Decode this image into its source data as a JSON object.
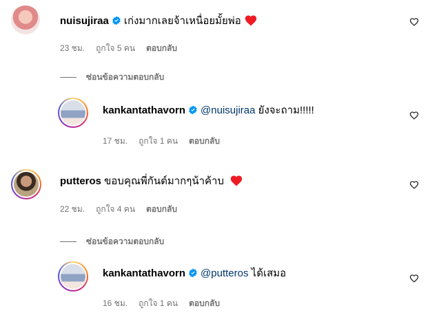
{
  "comments": [
    {
      "username": "nuisujiraa",
      "verified": true,
      "text": "เก่งมากเลยจ้าเหนื่อยมั้ยพ่อ",
      "emoji": "heart",
      "time": "23 ชม.",
      "likes": "ถูกใจ 5 คน",
      "reply_label": "ตอบกลับ",
      "view_replies": "ซ่อนข้อความตอบกลับ",
      "reply": {
        "username": "kankantathavorn",
        "verified": true,
        "mention": "@nuisujiraa",
        "text": "ยังจะถาม!!!!!",
        "time": "17 ชม.",
        "likes": "ถูกใจ 1 คน",
        "reply_label": "ตอบกลับ"
      }
    },
    {
      "username": "putteros",
      "verified": false,
      "text": "ขอบคุณพี่กันต์มากๆน้าค้าบ",
      "emoji": "heart",
      "time": "22 ชม.",
      "likes": "ถูกใจ 4 คน",
      "reply_label": "ตอบกลับ",
      "view_replies": "ซ่อนข้อความตอบกลับ",
      "reply": {
        "username": "kankantathavorn",
        "verified": true,
        "mention": "@putteros",
        "text": "ได้เสมอ",
        "time": "16 ชม.",
        "likes": "ถูกใจ 1 คน",
        "reply_label": "ตอบกลับ"
      }
    }
  ],
  "colors": {
    "verified": "#0095f6",
    "heart": "#ed1c24",
    "meta": "#737373",
    "mention": "#00376b"
  }
}
